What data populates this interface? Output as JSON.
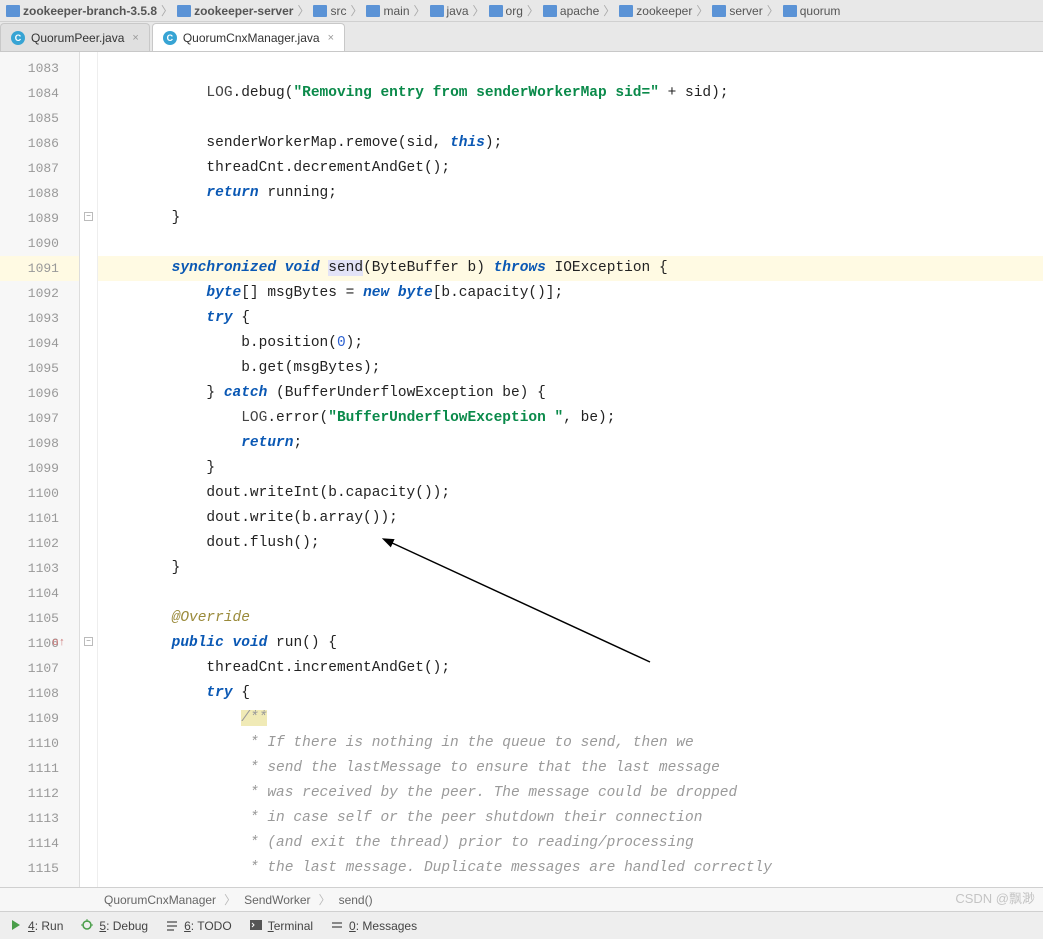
{
  "breadcrumbs": [
    "zookeeper-branch-3.5.8",
    "zookeeper-server",
    "src",
    "main",
    "java",
    "org",
    "apache",
    "zookeeper",
    "server",
    "quorum"
  ],
  "tabs": [
    {
      "icon": "C",
      "label": "QuorumPeer.java",
      "active": false
    },
    {
      "icon": "C",
      "label": "QuorumCnxManager.java",
      "active": true
    }
  ],
  "gutter_start": 1083,
  "gutter_end": 1115,
  "override_line": 1106,
  "bulb_line": 1091,
  "fold_markers": [
    {
      "line": 1089,
      "sym": "−"
    },
    {
      "line": 1106,
      "sym": "−"
    }
  ],
  "code_lines": [
    "",
    "            <span class=\"fn\">LOG</span>.debug(<span class=\"str\">\"Removing entry from senderWorkerMap sid=\"</span> + sid);",
    "",
    "            senderWorkerMap.remove(sid, <span class=\"kw\">this</span>);",
    "            threadCnt.decrementAndGet();",
    "            <span class=\"kw\">return</span> running;",
    "        }",
    "",
    "        <span class=\"kw\">synchronized</span> <span class=\"kw\">void</span> <span class=\"sel\">send</span>(ByteBuffer b) <span class=\"kw\">throws</span> IOException {",
    "            <span class=\"kw\">byte</span>[] msgBytes = <span class=\"kw\">new</span> <span class=\"kw\">byte</span>[b.capacity()];",
    "            <span class=\"kw\">try</span> {",
    "                b.position(<span class=\"num\">0</span>);",
    "                b.get(msgBytes);",
    "            } <span class=\"kw\">catch</span> (BufferUnderflowException be) {",
    "                <span class=\"fn\">LOG</span>.error(<span class=\"str\">\"BufferUnderflowException \"</span>, be);",
    "                <span class=\"kw\">return</span>;",
    "            }",
    "            dout.writeInt(b.capacity());",
    "            dout.write(b.array());",
    "            dout.flush();",
    "        }",
    "",
    "        <span class=\"ann\">@Override</span>",
    "        <span class=\"kw\">public</span> <span class=\"kw\">void</span> run() {",
    "            threadCnt.incrementAndGet();",
    "            <span class=\"kw\">try</span> {",
    "                <span class=\"doc-start com\">/**</span>",
    "<span class=\"com\">                 * If there is nothing in the queue to send, then we</span>",
    "<span class=\"com\">                 * send the lastMessage to ensure that the last message</span>",
    "<span class=\"com\">                 * was received by the peer. The message could be dropped</span>",
    "<span class=\"com\">                 * in case self or the peer shutdown their connection</span>",
    "<span class=\"com\">                 * (and exit the thread) prior to reading/processing</span>",
    "<span class=\"com\">                 * the last message. Duplicate messages are handled correctly</span>"
  ],
  "highlight_line_index": 8,
  "nav_crumbs": [
    "QuorumCnxManager",
    "SendWorker",
    "send()"
  ],
  "tools": [
    {
      "icon": "run-icon",
      "label": "4: Run",
      "ul": "4"
    },
    {
      "icon": "debug-icon",
      "label": "5: Debug",
      "ul": "5"
    },
    {
      "icon": "todo-icon",
      "label": "6: TODO",
      "ul": "6"
    },
    {
      "icon": "terminal-icon",
      "label": "Terminal",
      "ul": "T"
    },
    {
      "icon": "messages-icon",
      "label": "0: Messages",
      "ul": "0"
    }
  ],
  "watermark": "CSDN @飘渺"
}
